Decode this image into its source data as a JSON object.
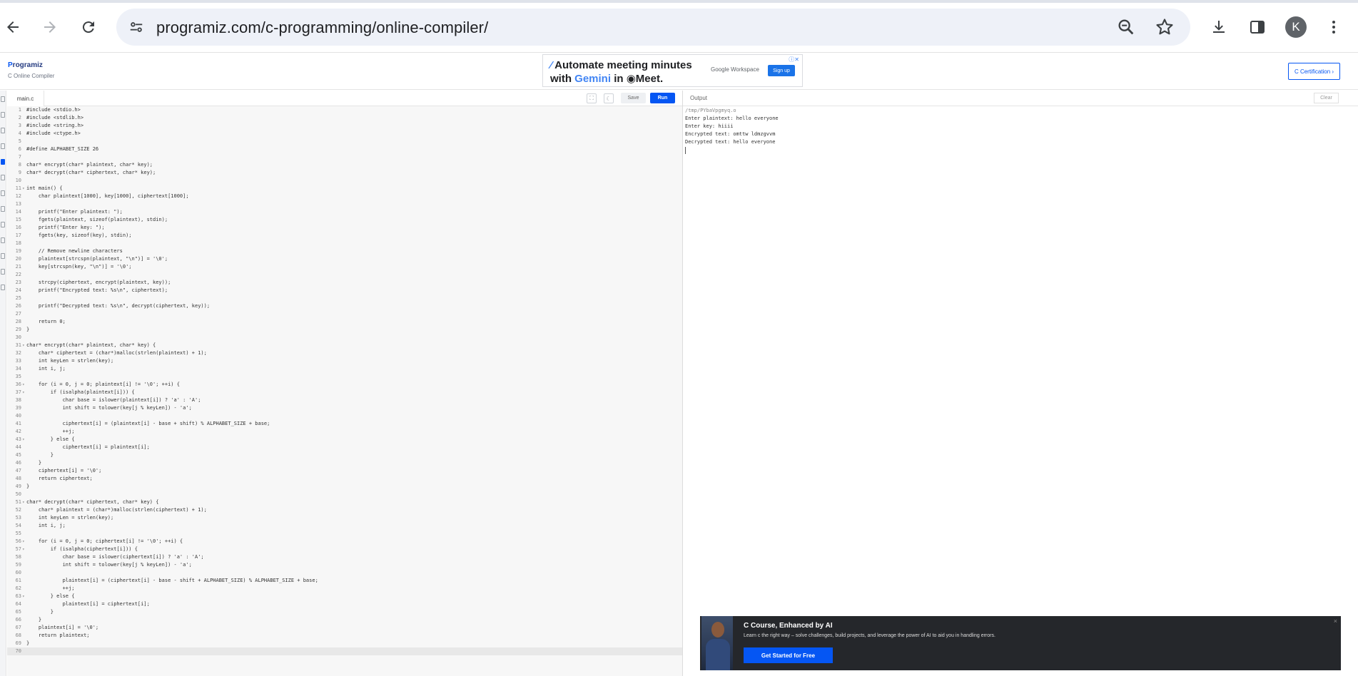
{
  "browser": {
    "url": "programiz.com/c-programming/online-compiler/",
    "profile_initial": "K",
    "icons": [
      "back-icon",
      "forward-icon",
      "reload-icon",
      "site-info-icon",
      "zoom-icon",
      "bookmark-star-icon",
      "download-icon",
      "side-panel-icon",
      "more-menu-icon"
    ]
  },
  "site": {
    "logo": "Programiz",
    "logo_first": "P",
    "logo_rest": "rogramiz",
    "subtitle": "C Online Compiler",
    "certification_button": "C Certification ›"
  },
  "ad": {
    "line1": "Automate meeting minutes",
    "line2_prefix": "with ",
    "line2_gemini": "Gemini",
    "line2_suffix": " in ◉Meet.",
    "brand": "Google Workspace",
    "cta": "Sign up"
  },
  "editor": {
    "file_tab": "main.c",
    "save_label": "Save",
    "run_label": "Run",
    "lines": [
      "#include <stdio.h>",
      "#include <stdlib.h>",
      "#include <string.h>",
      "#include <ctype.h>",
      "",
      "#define ALPHABET_SIZE 26",
      "",
      "char* encrypt(char* plaintext, char* key);",
      "char* decrypt(char* ciphertext, char* key);",
      "",
      "int main() {",
      "    char plaintext[1000], key[1000], ciphertext[1000];",
      "",
      "    printf(\"Enter plaintext: \");",
      "    fgets(plaintext, sizeof(plaintext), stdin);",
      "    printf(\"Enter key: \");",
      "    fgets(key, sizeof(key), stdin);",
      "",
      "    // Remove newline characters",
      "    plaintext[strcspn(plaintext, \"\\n\")] = '\\0';",
      "    key[strcspn(key, \"\\n\")] = '\\0';",
      "",
      "    strcpy(ciphertext, encrypt(plaintext, key));",
      "    printf(\"Encrypted text: %s\\n\", ciphertext);",
      "",
      "    printf(\"Decrypted text: %s\\n\", decrypt(ciphertext, key));",
      "",
      "    return 0;",
      "}",
      "",
      "char* encrypt(char* plaintext, char* key) {",
      "    char* ciphertext = (char*)malloc(strlen(plaintext) + 1);",
      "    int keyLen = strlen(key);",
      "    int i, j;",
      "",
      "    for (i = 0, j = 0; plaintext[i] != '\\0'; ++i) {",
      "        if (isalpha(plaintext[i])) {",
      "            char base = islower(plaintext[i]) ? 'a' : 'A';",
      "            int shift = tolower(key[j % keyLen]) - 'a';",
      "",
      "            ciphertext[i] = (plaintext[i] - base + shift) % ALPHABET_SIZE + base;",
      "            ++j;",
      "        } else {",
      "            ciphertext[i] = plaintext[i];",
      "        }",
      "    }",
      "    ciphertext[i] = '\\0';",
      "    return ciphertext;",
      "}",
      "",
      "char* decrypt(char* ciphertext, char* key) {",
      "    char* plaintext = (char*)malloc(strlen(ciphertext) + 1);",
      "    int keyLen = strlen(key);",
      "    int i, j;",
      "",
      "    for (i = 0, j = 0; ciphertext[i] != '\\0'; ++i) {",
      "        if (isalpha(ciphertext[i])) {",
      "            char base = islower(ciphertext[i]) ? 'a' : 'A';",
      "            int shift = tolower(key[j % keyLen]) - 'a';",
      "",
      "            plaintext[i] = (ciphertext[i] - base - shift + ALPHABET_SIZE) % ALPHABET_SIZE + base;",
      "            ++j;",
      "        } else {",
      "            plaintext[i] = ciphertext[i];",
      "        }",
      "    }",
      "    plaintext[i] = '\\0';",
      "    return plaintext;",
      "}",
      ""
    ],
    "fold_lines": [
      11,
      31,
      36,
      37,
      43,
      51,
      56,
      57,
      63
    ],
    "current_line": 70
  },
  "output": {
    "title": "Output",
    "clear_label": "Clear",
    "lines": [
      "/tmp/PYbaVpgmyq.o",
      "Enter plaintext: hello everyone",
      "Enter key: hiiii",
      "Encrypted text: omttw ldmzgvvm",
      "Decrypted text: hello everyone"
    ]
  },
  "promo": {
    "title": "C Course, Enhanced by AI",
    "subtitle": "Learn c the right way – solve challenges, build projects, and leverage the power of AI to aid you in handling errors.",
    "cta": "Get Started for Free",
    "close": "×"
  },
  "colors": {
    "accent": "#0556f3",
    "omnibox": "#eef1f8",
    "promo_bg": "#25272b"
  }
}
